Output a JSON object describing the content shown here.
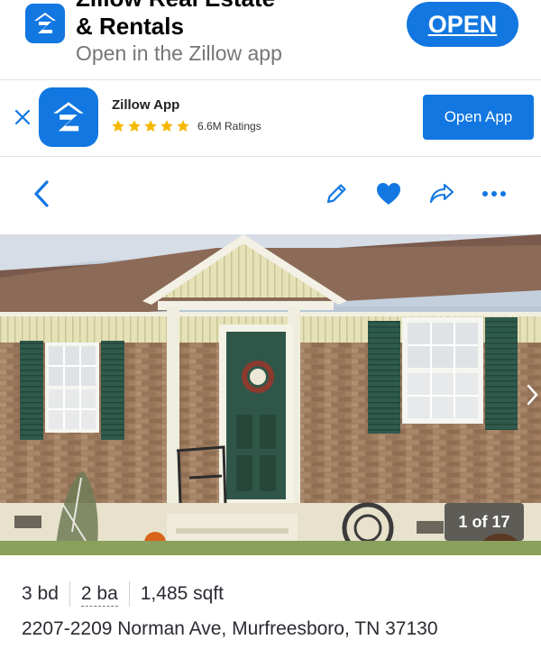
{
  "promo": {
    "title_line1": "Zillow Real Estate",
    "title_line2": "& Rentals",
    "subtitle": "Open in the Zillow app",
    "open_label": "OPEN"
  },
  "app_banner": {
    "app_name": "Zillow App",
    "stars": 5,
    "ratings": "6.6M Ratings",
    "open_label": "Open App"
  },
  "toolbar": {
    "icons": [
      "back-chevron-icon",
      "edit-pencil-icon",
      "heart-icon",
      "share-icon",
      "more-dots-icon"
    ],
    "accent_color": "#1277e1"
  },
  "photo": {
    "counter": "1 of 17"
  },
  "listing": {
    "beds": "3 bd",
    "baths": "2 ba",
    "sqft": "1,485 sqft",
    "address": "2207-2209 Norman Ave, Murfreesboro, TN 37130"
  },
  "colors": {
    "brand": "#1277e1",
    "text": "#2a2a33",
    "star": "#f5b800"
  }
}
